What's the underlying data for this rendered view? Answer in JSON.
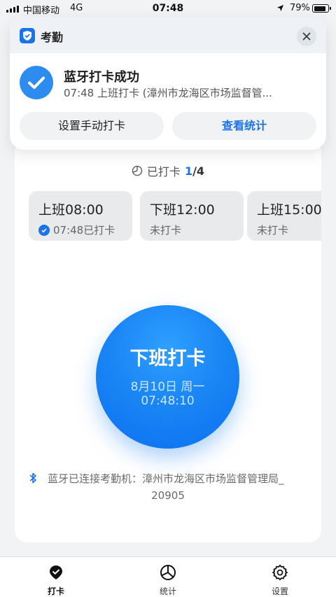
{
  "status_bar": {
    "carrier": "中国移动",
    "network": "4G",
    "time": "07:48",
    "battery": "79%",
    "battery_level": 0.79
  },
  "notification": {
    "app_name": "考勤",
    "title": "蓝牙打卡成功",
    "subtitle": "07:48 上班打卡 (漳州市龙海区市场监督管...",
    "left_action": "设置手动打卡",
    "right_action": "查看统计"
  },
  "summary": {
    "label": "已打卡",
    "done": "1",
    "total": "/4"
  },
  "shifts": [
    {
      "time": "上班08:00",
      "state": "07:48已打卡",
      "done": true
    },
    {
      "time": "下班12:00",
      "state": "未打卡",
      "done": false
    },
    {
      "time": "上班15:00",
      "state": "未打卡",
      "done": false
    }
  ],
  "punch": {
    "label": "下班打卡",
    "date": "8月10日 周一",
    "time": "07:48:10"
  },
  "bluetooth": {
    "line1": "蓝牙已连接考勤机：漳州市龙海区市场监督管理局_",
    "line2": "20905"
  },
  "tabs": [
    {
      "label": "打卡",
      "icon": "checkin-icon",
      "active": true
    },
    {
      "label": "统计",
      "icon": "stats-pie-icon",
      "active": false
    },
    {
      "label": "设置",
      "icon": "gear-icon",
      "active": false
    }
  ],
  "colors": {
    "accent": "#1a73e8",
    "button": "#1a86f5"
  }
}
